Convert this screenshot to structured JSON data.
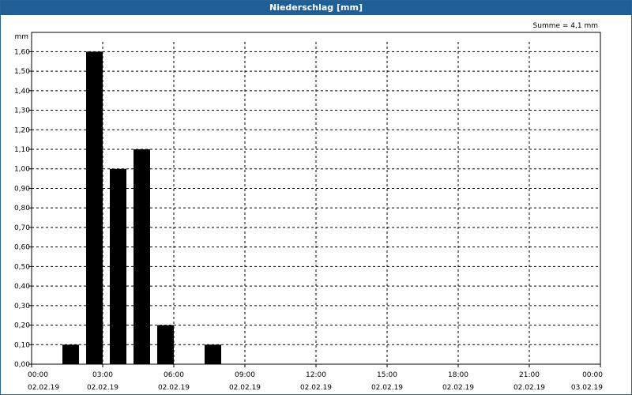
{
  "window": {
    "title": "Niederschlag [mm]"
  },
  "chart_data": {
    "type": "bar",
    "title": "Niederschlag [mm]",
    "annotation": "Summe = 4,1 mm",
    "ylabel": "mm",
    "xlabel": "",
    "ylim": [
      0,
      1.65
    ],
    "yticks": [
      "0,00",
      "0,10",
      "0,20",
      "0,30",
      "0,40",
      "0,50",
      "0,60",
      "0,70",
      "0,80",
      "0,90",
      "1,00",
      "1,10",
      "1,20",
      "1,30",
      "1,40",
      "1,50",
      "1,60"
    ],
    "xlim_hours": [
      0,
      24
    ],
    "xticks": [
      {
        "time": "00:00",
        "date": "02.02.19"
      },
      {
        "time": "03:00",
        "date": "02.02.19"
      },
      {
        "time": "06:00",
        "date": "02.02.19"
      },
      {
        "time": "09:00",
        "date": "02.02.19"
      },
      {
        "time": "12:00",
        "date": "02.02.19"
      },
      {
        "time": "15:00",
        "date": "02.02.19"
      },
      {
        "time": "18:00",
        "date": "02.02.19"
      },
      {
        "time": "21:00",
        "date": "02.02.19"
      },
      {
        "time": "00:00",
        "date": "03.02.19"
      }
    ],
    "x": [
      "02:00",
      "03:00",
      "04:00",
      "05:00",
      "06:00",
      "08:00"
    ],
    "values": [
      0.1,
      1.6,
      1.0,
      1.1,
      0.2,
      0.1
    ],
    "grid": true,
    "bar_color": "#000000"
  }
}
